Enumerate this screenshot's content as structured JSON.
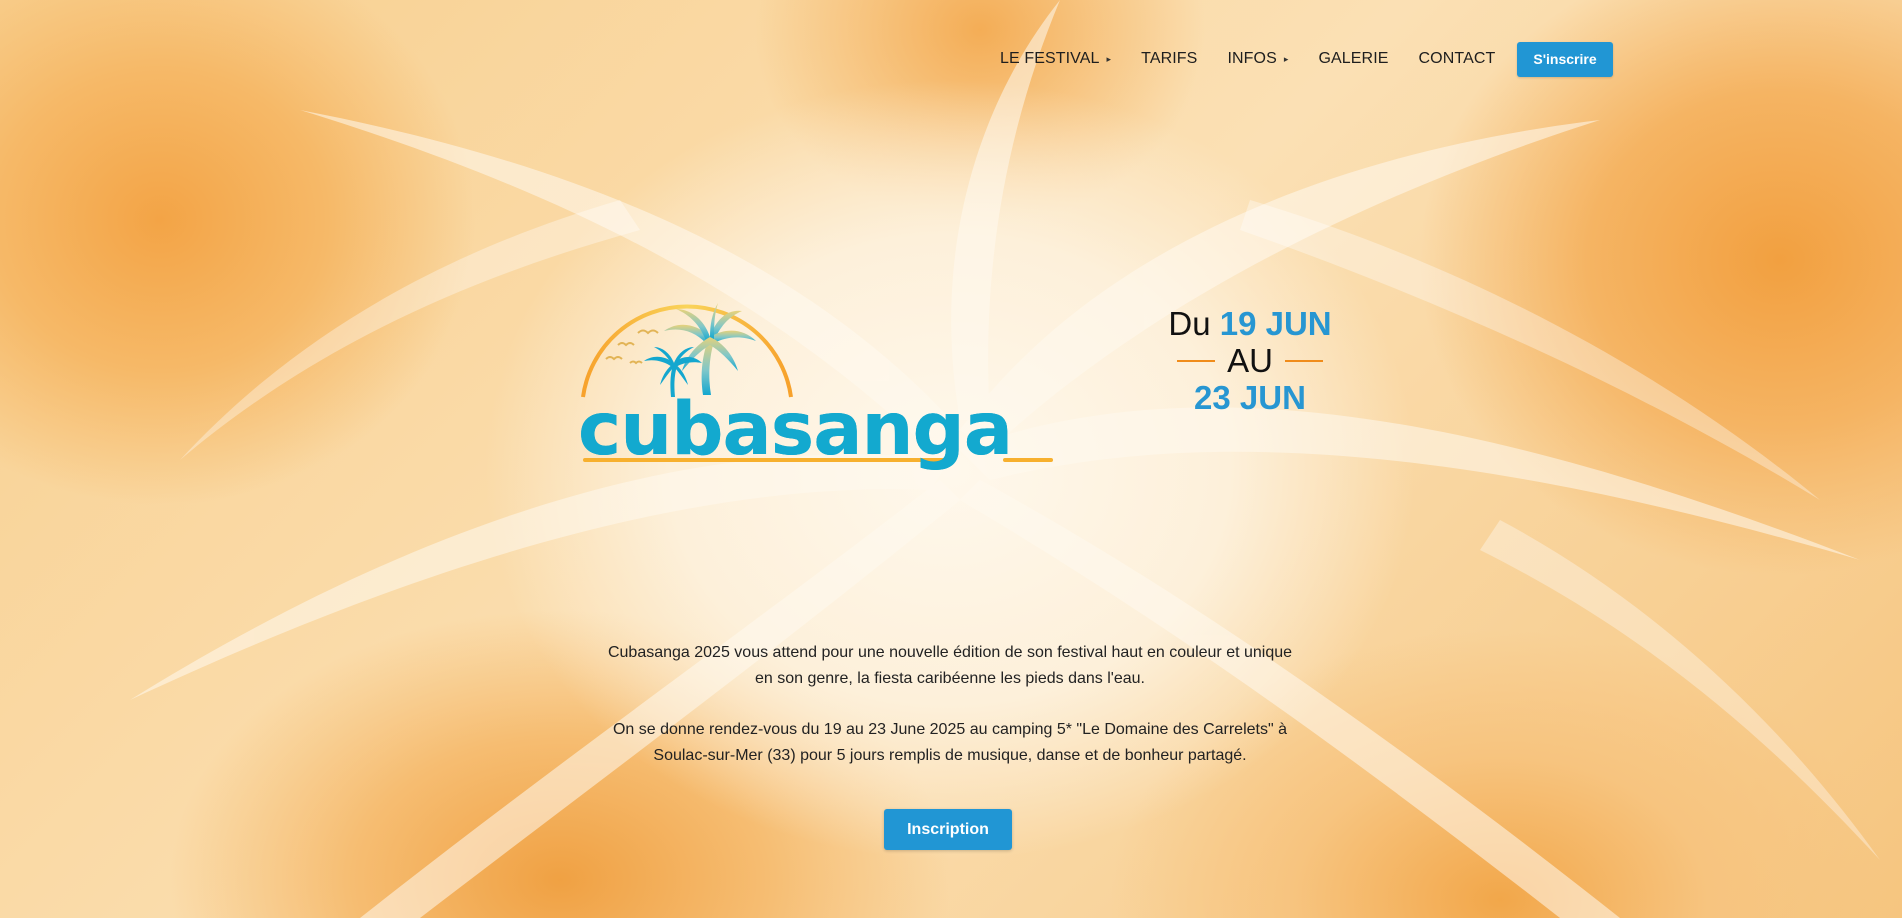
{
  "nav": {
    "items": [
      {
        "label": "LE FESTIVAL",
        "has_submenu": true
      },
      {
        "label": "TARIFS",
        "has_submenu": false
      },
      {
        "label": "INFOS",
        "has_submenu": true
      },
      {
        "label": "GALERIE",
        "has_submenu": false
      },
      {
        "label": "CONTACT",
        "has_submenu": false
      }
    ],
    "cta_label": "S'inscrire"
  },
  "logo": {
    "wordmark": "cubasanga",
    "icon": "palm-tree-sunset-logo"
  },
  "dates": {
    "prefix": "Du",
    "start": "19 JUN",
    "middle": "AU",
    "end": "23 JUN"
  },
  "description": {
    "paragraph1": "Cubasanga 2025 vous attend pour une nouvelle édition de son festival haut en couleur et unique en son genre, la fiesta caribéenne les pieds dans l'eau.",
    "paragraph2": "On se donne rendez-vous du 19 au 23 June 2025 au camping 5* \"Le Domaine des Carrelets\" à Soulac-sur-Mer (33) pour 5 jours remplis de musique, danse et de bonheur partagé."
  },
  "cta": {
    "label": "Inscription"
  },
  "colors": {
    "accent_blue": "#2196d4",
    "logo_blue": "#13a9cf",
    "sun_yellow": "#f7c843",
    "dash_orange": "#f08c1b"
  }
}
